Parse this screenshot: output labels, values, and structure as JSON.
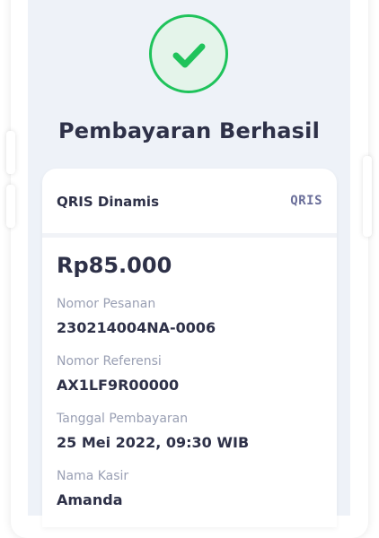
{
  "header": {
    "title": "Pembayaran Berhasil"
  },
  "status": {
    "icon": "check-icon",
    "color": "#1fc35b"
  },
  "payment": {
    "method": "QRIS Dinamis",
    "logo_text": "QRIS",
    "amount": "Rp85.000"
  },
  "details": [
    {
      "label": "Nomor Pesanan",
      "value": "230214004NA-0006"
    },
    {
      "label": "Nomor Referensi",
      "value": "AX1LF9R00000"
    },
    {
      "label": "Tanggal Pembayaran",
      "value": "25 Mei 2022, 09:30 WIB"
    },
    {
      "label": "Nama Kasir",
      "value": "Amanda"
    }
  ]
}
